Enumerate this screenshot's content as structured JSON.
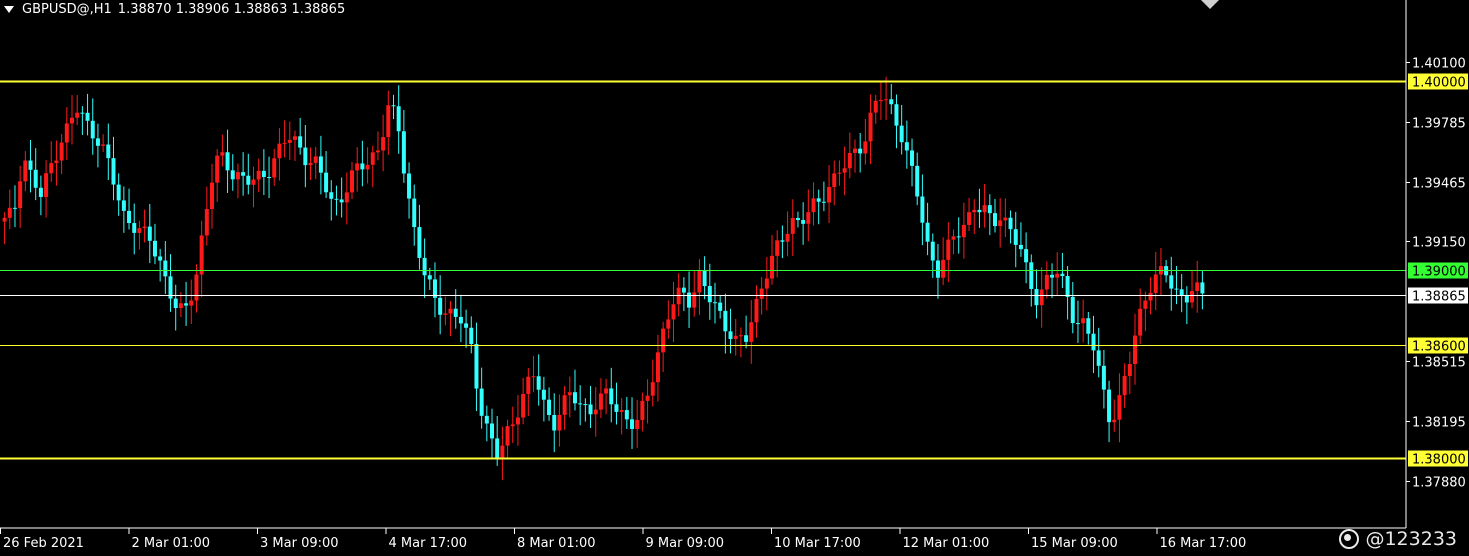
{
  "header": {
    "symbol": "GBPUSD@,H1",
    "ohlc": "1.38870 1.38906 1.38863 1.38865"
  },
  "watermark": "@123233",
  "colors": {
    "bull": "#ff1a1a",
    "bear": "#33ffff",
    "background": "#000000",
    "axis": "#ffffff",
    "line_yellow": "#ffff33",
    "line_green": "#33ff33",
    "line_price": "#ffffff"
  },
  "chart_data": {
    "type": "candlestick",
    "symbol": "GBPUSD@",
    "timeframe": "H1",
    "ylim": [
      1.3763,
      1.4043
    ],
    "y_ticks": [
      "1.40100",
      "1.39785",
      "1.39465",
      "1.39150",
      "1.38515",
      "1.38195",
      "1.37880"
    ],
    "x_labels": [
      "26 Feb 2021",
      "2 Mar 01:00",
      "3 Mar 09:00",
      "4 Mar 17:00",
      "8 Mar 01:00",
      "9 Mar 09:00",
      "10 Mar 17:00",
      "12 Mar 01:00",
      "15 Mar 09:00",
      "16 Mar 17:00"
    ],
    "horizontal_lines": [
      {
        "value": 1.4,
        "label": "1.40000",
        "color": "#ffff33",
        "label_bg": "#ffff33",
        "label_color": "#000000"
      },
      {
        "value": 1.39,
        "label": "1.39000",
        "color": "#33ff33",
        "label_bg": "#33ff33",
        "label_color": "#000000"
      },
      {
        "value": 1.38865,
        "label": "1.38865",
        "color": "#ffffff",
        "label_bg": "#ffffff",
        "label_color": "#000000"
      },
      {
        "value": 1.386,
        "label": "1.38600",
        "color": "#ffff33",
        "label_bg": "#ffff33",
        "label_color": "#000000"
      },
      {
        "value": 1.38,
        "label": "1.38000",
        "color": "#ffff33",
        "label_bg": "#ffff33",
        "label_color": "#000000"
      }
    ],
    "close_path": [
      1.3925,
      1.393,
      1.3962,
      1.3948,
      1.3938,
      1.3955,
      1.3968,
      1.3975,
      1.3985,
      1.3978,
      1.3972,
      1.396,
      1.3945,
      1.393,
      1.3925,
      1.3918,
      1.3915,
      1.3905,
      1.389,
      1.3875,
      1.388,
      1.39,
      1.393,
      1.3955,
      1.396,
      1.3952,
      1.3948,
      1.3945,
      1.395,
      1.3955,
      1.3962,
      1.397,
      1.3968,
      1.396,
      1.3955,
      1.3945,
      1.3935,
      1.394,
      1.3948,
      1.3955,
      1.396,
      1.3965,
      1.3985,
      1.3978,
      1.3945,
      1.3915,
      1.3895,
      1.3885,
      1.388,
      1.3875,
      1.3872,
      1.386,
      1.383,
      1.381,
      1.38,
      1.3815,
      1.3825,
      1.3835,
      1.3845,
      1.383,
      1.3818,
      1.3825,
      1.3835,
      1.383,
      1.3825,
      1.3828,
      1.3835,
      1.3828,
      1.382,
      1.3815,
      1.383,
      1.3848,
      1.3865,
      1.388,
      1.389,
      1.3885,
      1.3895,
      1.3885,
      1.388,
      1.387,
      1.386,
      1.3862,
      1.388,
      1.3895,
      1.3905,
      1.3915,
      1.3928,
      1.3925,
      1.393,
      1.3935,
      1.3945,
      1.395,
      1.3955,
      1.3962,
      1.397,
      1.3985,
      1.3992,
      1.3985,
      1.3975,
      1.3955,
      1.3935,
      1.3912,
      1.39,
      1.3908,
      1.3918,
      1.3925,
      1.3935,
      1.393,
      1.3925,
      1.393,
      1.3922,
      1.391,
      1.3895,
      1.3885,
      1.3895,
      1.3898,
      1.389,
      1.3875,
      1.387,
      1.386,
      1.384,
      1.382,
      1.383,
      1.385,
      1.3875,
      1.389,
      1.3895,
      1.3898,
      1.389,
      1.3885,
      1.3888,
      1.38865
    ],
    "last_price": 1.38865
  }
}
